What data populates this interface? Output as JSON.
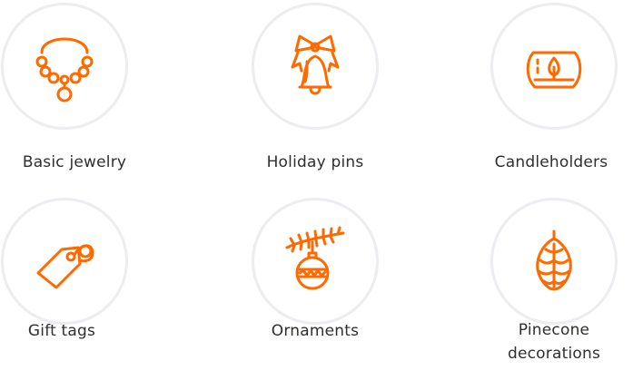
{
  "accent_color": "#ff6a00",
  "circle_border_color": "#ececf1",
  "items": [
    {
      "label": "Basic jewelry",
      "icon": "necklace-icon"
    },
    {
      "label": "Holiday pins",
      "icon": "bell-with-bow-icon"
    },
    {
      "label": "Candleholders",
      "icon": "candle-holder-icon"
    },
    {
      "label": "Gift tags",
      "icon": "gift-tag-icon"
    },
    {
      "label": "Ornaments",
      "icon": "ornament-icon"
    },
    {
      "label": "Pinecone decorations",
      "icon": "pinecone-icon"
    }
  ]
}
